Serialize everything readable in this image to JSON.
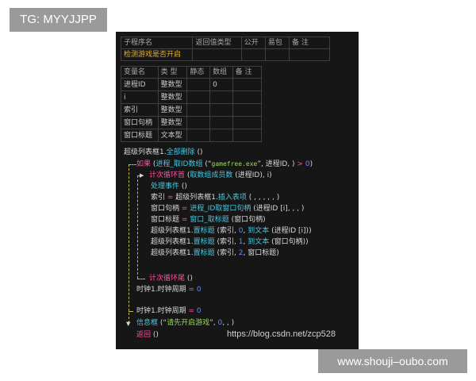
{
  "tags": {
    "top_left": "TG: MYYJJPP",
    "bottom_right": "www.shouji–oubo.com"
  },
  "sub_table": {
    "headers": [
      "子程序名",
      "返回值类型",
      "公开",
      "易包",
      "备 注"
    ],
    "row": [
      "检测游戏是否开启",
      "",
      "",
      "",
      ""
    ]
  },
  "var_table": {
    "headers": [
      "变量名",
      "类 型",
      "静态",
      "数组",
      "备 注"
    ],
    "rows": [
      [
        "进程ID",
        "整数型",
        "",
        "0",
        ""
      ],
      [
        "i",
        "整数型",
        "",
        "",
        ""
      ],
      [
        "索引",
        "整数型",
        "",
        "",
        ""
      ],
      [
        "窗口句柄",
        "整数型",
        "",
        "",
        ""
      ],
      [
        "窗口标题",
        "文本型",
        "",
        "",
        ""
      ]
    ]
  },
  "code": {
    "l1": {
      "a": "超级列表框1",
      "b": ".",
      "c": "全部删除",
      "d": " ()"
    },
    "l2": {
      "a": "如果",
      "b": " (",
      "c": "进程_取ID数组",
      "d": " (“",
      "e": "gamefree.exe",
      "f": "”, 进程ID, ) ",
      "g": ">",
      "h": " ",
      "i": "0",
      "j": ")"
    },
    "l3": {
      "a": "计次循环首",
      "b": " (",
      "c": "取数组成员数",
      "d": " (进程ID), i)"
    },
    "l4": {
      "a": "处理事件",
      "b": " ()"
    },
    "l5": {
      "a": "索引",
      "b": " = ",
      "c": "超级列表框1",
      "d": ".",
      "e": "插入表项",
      "f": " ( , , , , , )"
    },
    "l6": {
      "a": "窗口句柄",
      "b": " = ",
      "c": "进程_ID取窗口句柄",
      "d": " (进程ID [i], , , )"
    },
    "l7": {
      "a": "窗口标题",
      "b": " = ",
      "c": "窗口_取标题",
      "d": " (窗口句柄)"
    },
    "l8": {
      "a": "超级列表框1",
      "b": ".",
      "c": "置标题",
      "d": " (索引, ",
      "e": "0",
      "f": ", ",
      "g": "到文本",
      "h": " (进程ID [i]))"
    },
    "l9": {
      "a": "超级列表框1",
      "b": ".",
      "c": "置标题",
      "d": " (索引, ",
      "e": "1",
      "f": ", ",
      "g": "到文本",
      "h": " (窗口句柄))"
    },
    "l10": {
      "a": "超级列表框1",
      "b": ".",
      "c": "置标题",
      "d": " (索引, ",
      "e": "2",
      "f": ", 窗口标题)"
    },
    "l11": {
      "a": "计次循环尾",
      "b": " ()"
    },
    "l12": {
      "a": "时钟1",
      "b": ".",
      "c": "时钟周期",
      "d": " = ",
      "e": "0"
    },
    "l13": {
      "a": "时钟1",
      "b": ".",
      "c": "时钟周期",
      "d": " = ",
      "e": "0"
    },
    "l14": {
      "a": "信息框",
      "b": " (“",
      "c": "请先开启游戏",
      "d": "”, ",
      "e": "0",
      "f": ", , )"
    },
    "l15": {
      "a": "返回",
      "b": " ()"
    }
  },
  "watermark": "https://blog.csdn.net/zcp528",
  "colors": {
    "keyword": "#ff4fa0",
    "function": "#45c8e0",
    "number": "#5d8cff",
    "text": "#d8d8d8",
    "highlight": "#e3b23c",
    "string": "#9dd36b"
  }
}
